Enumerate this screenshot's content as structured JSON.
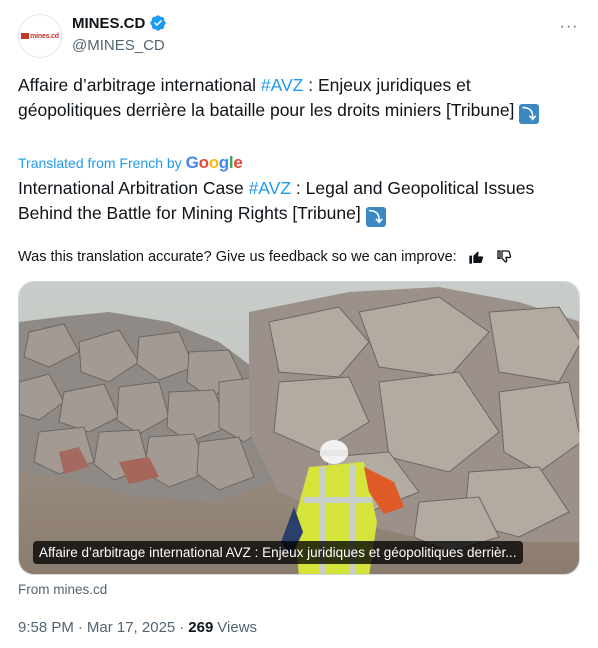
{
  "author": {
    "display_name": "MINES.CD",
    "handle": "@MINES_CD",
    "avatar_text": "mines.cd",
    "verified": true
  },
  "more_label": "···",
  "original": {
    "before": "Affaire d’arbitrage international ",
    "hashtag": "#AVZ",
    "after": " : Enjeux juridiques et géopolitiques derrière la bataille pour les droits miniers [Tribune] ",
    "emoji": "⤵"
  },
  "translated_by": {
    "label": "Translated from French by",
    "google": [
      "G",
      "o",
      "o",
      "g",
      "l",
      "e"
    ]
  },
  "translation": {
    "before": "International Arbitration Case ",
    "hashtag": "#AVZ",
    "after": " : Legal and Geopolitical Issues Behind the Battle for Mining Rights [Tribune] ",
    "emoji": "⤵"
  },
  "feedback": {
    "question": "Was this translation accurate? Give us feedback so we can improve:",
    "thumbs_up_icon": "thumbs-up-icon",
    "thumbs_down_icon": "thumbs-down-icon"
  },
  "link_card": {
    "caption": "Affaire d’arbitrage international AVZ : Enjeux juridiques et géopolitiques derrièr...",
    "source": "From mines.cd"
  },
  "meta": {
    "time": "9:58 PM",
    "sep1": "·",
    "date": "Mar 17, 2025",
    "sep2": "·",
    "views_count": "269",
    "views_label": "Views"
  },
  "colors": {
    "accent": "#1d9bf0",
    "text": "#0f1419",
    "muted": "#536471"
  }
}
